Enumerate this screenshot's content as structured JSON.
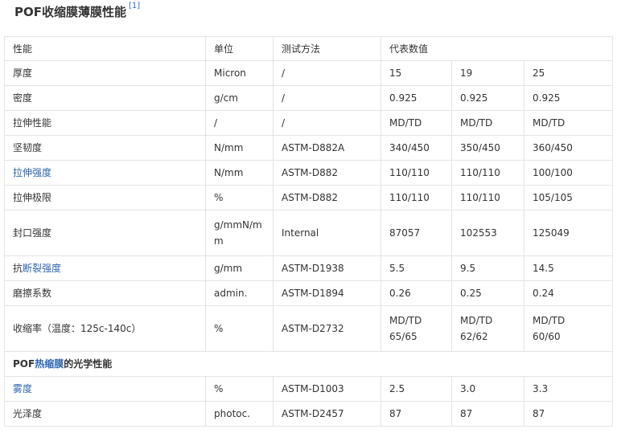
{
  "title": {
    "text": "POF收缩膜薄膜性能",
    "ref": "[1]"
  },
  "columns": [
    "性能",
    "单位",
    "测试方法",
    "代表数值"
  ],
  "rows": [
    {
      "prop": "厚度",
      "unit": "Micron",
      "method": "/",
      "v1": "15",
      "v2": "19",
      "v3": "25"
    },
    {
      "prop": "密度",
      "unit": "g/cm",
      "method": "/",
      "v1": "0.925",
      "v2": "0.925",
      "v3": "0.925"
    },
    {
      "prop": "拉伸性能",
      "unit": "/",
      "method": "/",
      "v1": "MD/TD",
      "v2": "MD/TD",
      "v3": "MD/TD"
    },
    {
      "prop": "坚韧度",
      "unit": "N/mm",
      "method": "ASTM-D882A",
      "v1": "340/450",
      "v2": "350/450",
      "v3": "360/450"
    },
    {
      "prop": "拉伸强度",
      "unit": "N/mm",
      "method": "ASTM-D882",
      "v1": "110/110",
      "v2": "110/110",
      "v3": "100/100"
    },
    {
      "prop": "拉伸极限",
      "unit": "%",
      "method": "ASTM-D882",
      "v1": "110/110",
      "v2": "110/110",
      "v3": "105/105"
    },
    {
      "prop": "封口强度",
      "unit": "g/mmN/mm",
      "method": "Internal",
      "v1": "87057",
      "v2": "102553",
      "v3": "125049"
    },
    {
      "prop_pre": "抗",
      "prop_link": "断裂强度",
      "unit": "g/mm",
      "method": "ASTM-D1938",
      "v1": "5.5",
      "v2": "9.5",
      "v3": "14.5"
    },
    {
      "prop": "磨擦系数",
      "unit": "admin.",
      "method": "ASTM-D1894",
      "v1": "0.26",
      "v2": "0.25",
      "v3": "0.24"
    },
    {
      "prop": "收缩率（温度：125c-140c）",
      "unit": "%",
      "method": "ASTM-D2732",
      "v1": "MD/TD 65/65",
      "v2": "MD/TD 62/62",
      "v3": "MD/TD 60/60"
    }
  ],
  "optical_section": {
    "pre": "POF",
    "link": "热缩膜",
    "post": "的光学性能"
  },
  "optical_rows": [
    {
      "prop": "雾度",
      "unit": "%",
      "method": "ASTM-D1003",
      "v1": "2.5",
      "v2": "3.0",
      "v3": "3.3"
    },
    {
      "prop": "光泽度",
      "unit": "photoc.",
      "method": "ASTM-D2457",
      "v1": "87",
      "v2": "87",
      "v3": "87"
    }
  ],
  "colors": {
    "link": "#2d64b3",
    "border": "#e3e3e3",
    "text": "#333333"
  }
}
